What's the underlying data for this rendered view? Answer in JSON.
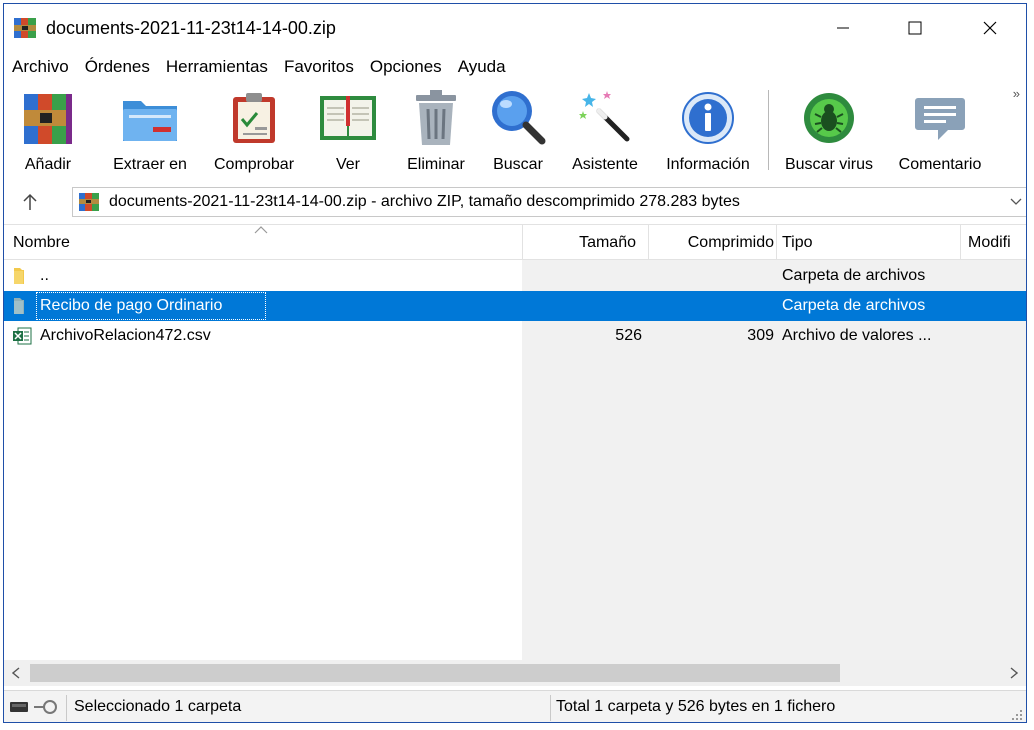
{
  "window": {
    "title": "documents-2021-11-23t14-14-00.zip",
    "icon": "winrar-archive-icon"
  },
  "menu": [
    "Archivo",
    "Órdenes",
    "Herramientas",
    "Favoritos",
    "Opciones",
    "Ayuda"
  ],
  "toolbar": {
    "buttons": [
      {
        "label": "Añadir",
        "icon": "books-add-icon"
      },
      {
        "label": "Extraer en",
        "icon": "folder-extract-icon"
      },
      {
        "label": "Comprobar",
        "icon": "clipboard-check-icon"
      },
      {
        "label": "Ver",
        "icon": "book-open-icon"
      },
      {
        "label": "Eliminar",
        "icon": "trash-bin-icon"
      },
      {
        "label": "Buscar",
        "icon": "magnifier-icon"
      },
      {
        "label": "Asistente",
        "icon": "magic-wand-icon"
      },
      {
        "label": "Información",
        "icon": "info-icon"
      },
      {
        "label": "Buscar virus",
        "icon": "bug-scan-icon"
      },
      {
        "label": "Comentario",
        "icon": "comment-icon"
      }
    ],
    "overflow": "»"
  },
  "address": {
    "text": "documents-2021-11-23t14-14-00.zip - archivo ZIP, tamaño descomprimido 278.283 bytes"
  },
  "columns": {
    "name": "Nombre",
    "size": "Tamaño",
    "compressed": "Comprimido",
    "type": "Tipo",
    "modified": "Modifi"
  },
  "rows": [
    {
      "name": "..",
      "size": "",
      "compressed": "",
      "type": "Carpeta de archivos",
      "icon": "folder-up-icon",
      "selected": false
    },
    {
      "name": "Recibo de pago Ordinario",
      "size": "",
      "compressed": "",
      "type": "Carpeta de archivos",
      "icon": "folder-icon",
      "selected": true
    },
    {
      "name": "ArchivoRelacion472.csv",
      "size": "526",
      "compressed": "309",
      "type": "Archivo de valores ...",
      "icon": "excel-csv-icon",
      "selected": false
    }
  ],
  "status": {
    "left": "Seleccionado 1 carpeta",
    "right": "Total 1 carpeta y 526 bytes en 1 fichero"
  },
  "colors": {
    "selection": "#0078d7",
    "window_border": "#1f4fa8"
  }
}
